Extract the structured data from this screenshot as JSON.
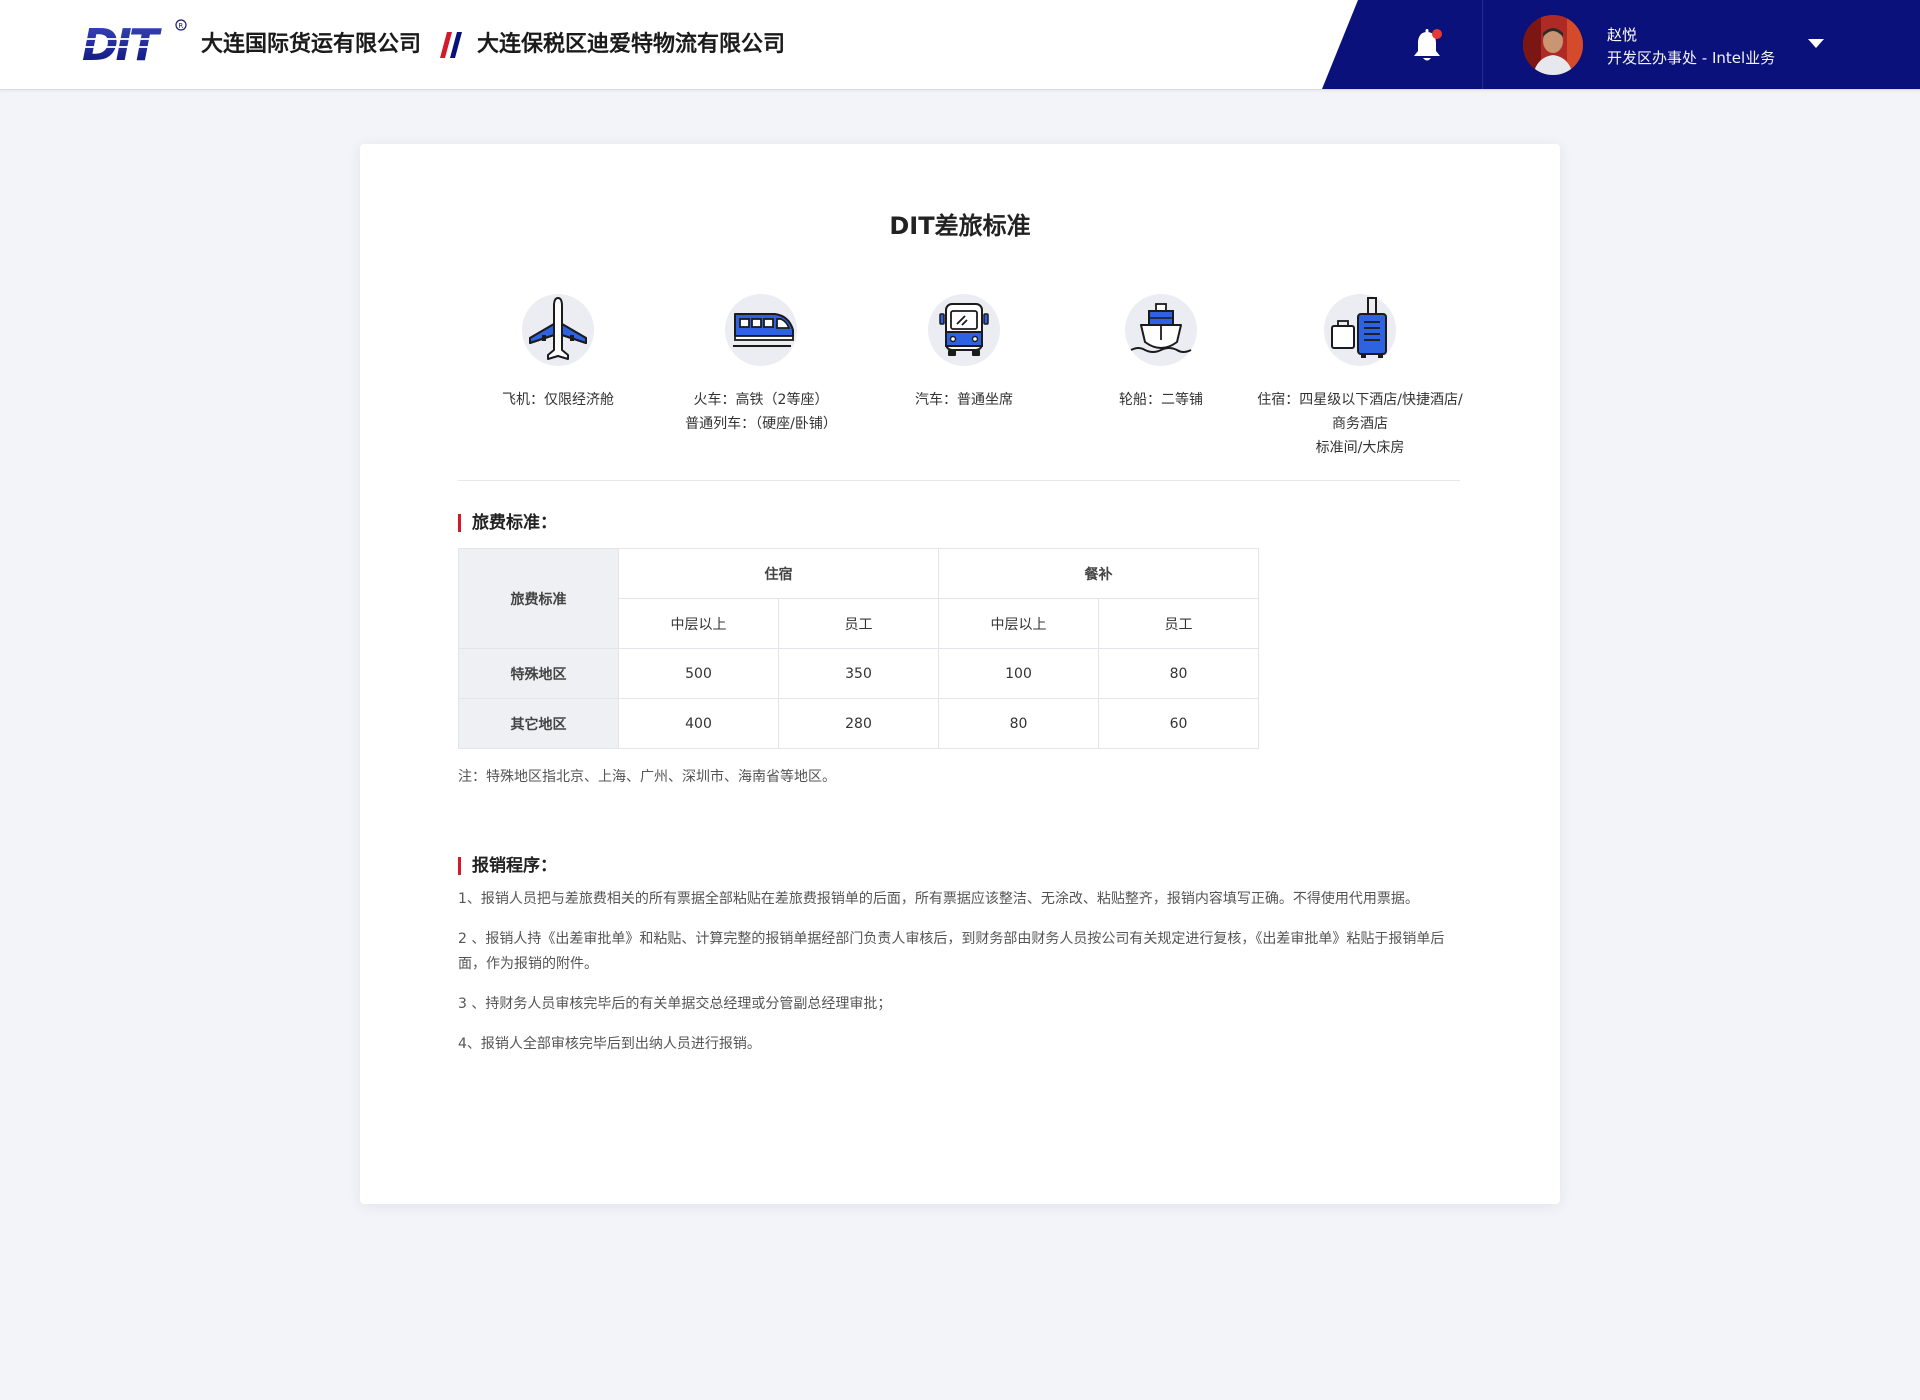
{
  "header": {
    "logo_text": "DIT",
    "company_1": "大连国际货运有限公司",
    "company_2": "大连保税区迪爱特物流有限公司",
    "bell_icon": "bell-icon",
    "user": {
      "name": "赵悦",
      "dept": "开发区办事处 - Intel业务"
    },
    "colors": {
      "nav_bg": "#0b117a",
      "accent_red": "#d21b2a",
      "icon_blue": "#2d63e0"
    }
  },
  "main": {
    "title": "DIT差旅标准",
    "transports": [
      {
        "icon": "airplane-icon",
        "lines": [
          "飞机：仅限经济舱"
        ]
      },
      {
        "icon": "train-icon",
        "lines": [
          "火车：高铁（2等座）",
          "普通列车：（硬座/卧铺）"
        ]
      },
      {
        "icon": "bus-icon",
        "lines": [
          "汽车：普通坐席"
        ]
      },
      {
        "icon": "ship-icon",
        "lines": [
          "轮船：二等铺"
        ]
      },
      {
        "icon": "luggage-icon",
        "lines": [
          "住宿：四星级以下酒店/快捷酒店/",
          "商务酒店",
          "标准间/大床房"
        ]
      }
    ],
    "fee_section": {
      "title": "旅费标准：",
      "table": {
        "corner": "旅费标准",
        "groups": [
          "住宿",
          "餐补"
        ],
        "sub_headers": [
          "中层以上",
          "员工",
          "中层以上",
          "员工"
        ],
        "rows": [
          {
            "label": "特殊地区",
            "values": [
              "500",
              "350",
              "100",
              "80"
            ]
          },
          {
            "label": "其它地区",
            "values": [
              "400",
              "280",
              "80",
              "60"
            ]
          }
        ]
      },
      "note": "注：特殊地区指北京、上海、广州、深圳市、海南省等地区。"
    },
    "procedure": {
      "title": "报销程序：",
      "items": [
        "1、报销人员把与差旅费相关的所有票据全部粘贴在差旅费报销单的后面，所有票据应该整洁、无涂改、粘贴整齐，报销内容填写正确。不得使用代用票据。",
        "2 、报销人持《出差审批单》和粘贴、计算完整的报销单据经部门负责人审核后，到财务部由财务人员按公司有关规定进行复核，《出差审批单》粘贴于报销单后面，作为报销的附件。",
        "3 、持财务人员审核完毕后的有关单据交总经理或分管副总经理审批；",
        "4、报销人全部审核完毕后到出纳人员进行报销。"
      ]
    }
  }
}
